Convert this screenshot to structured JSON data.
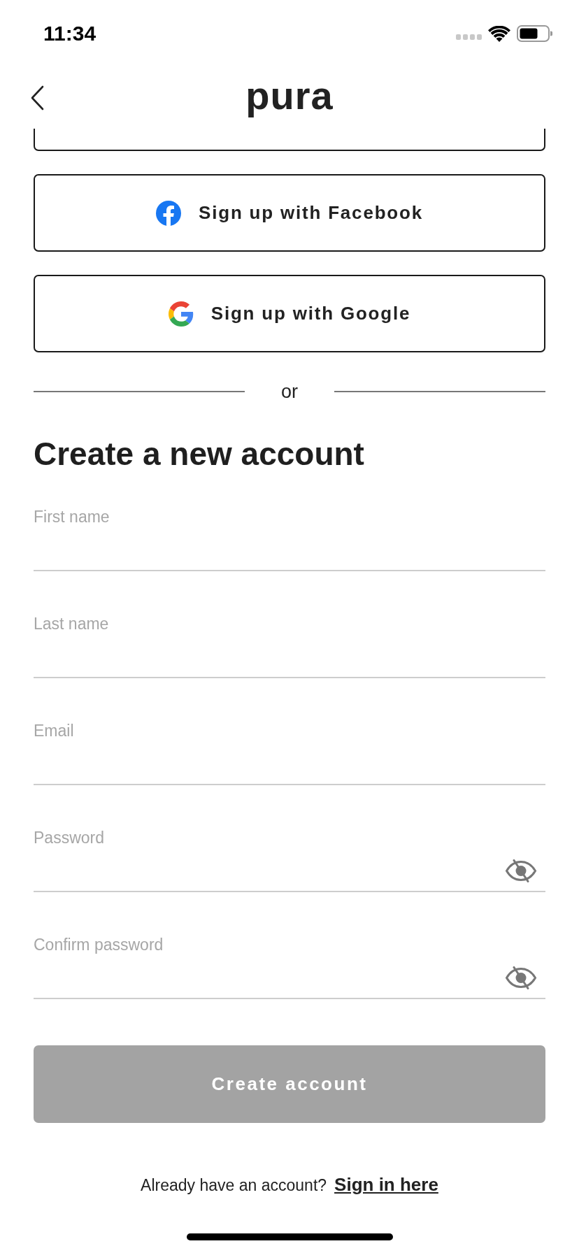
{
  "status_bar": {
    "time": "11:34"
  },
  "header": {
    "logo": "pura"
  },
  "social_buttons": [
    {
      "kind": "cut_off"
    },
    {
      "kind": "facebook",
      "label": "Sign up with Facebook"
    },
    {
      "kind": "google",
      "label": "Sign up with Google"
    }
  ],
  "divider": {
    "label": "or"
  },
  "form": {
    "title": "Create a new account",
    "fields": [
      {
        "label": "First name",
        "kind": "text"
      },
      {
        "label": "Last name",
        "kind": "text"
      },
      {
        "label": "Email",
        "kind": "text"
      },
      {
        "label": "Password",
        "kind": "password"
      },
      {
        "label": "Confirm password",
        "kind": "password"
      }
    ],
    "submit": {
      "label": "Create account",
      "disabled": true
    }
  },
  "footer": {
    "prompt": "Already have an account?",
    "link": "Sign in here"
  }
}
